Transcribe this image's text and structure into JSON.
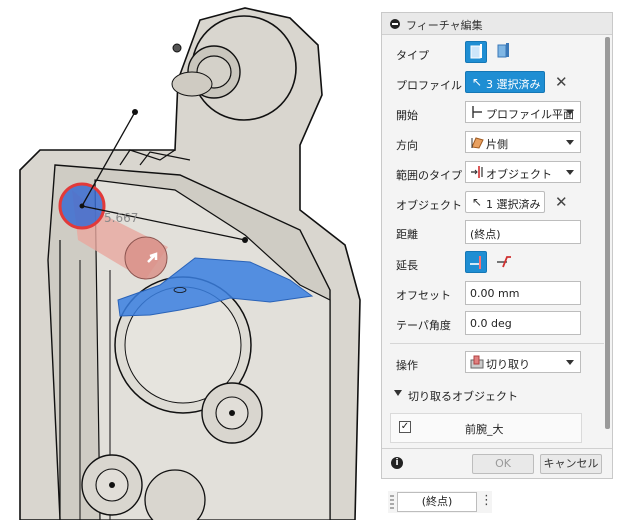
{
  "viewport": {
    "dimension_value": "5.667"
  },
  "panel": {
    "title": "フィーチャ編集",
    "rows": {
      "type": {
        "label": "タイプ"
      },
      "profile": {
        "label": "プロファイル",
        "value": "3 選択済み"
      },
      "start": {
        "label": "開始",
        "value": "プロファイル平面"
      },
      "direction": {
        "label": "方向",
        "value": "片側"
      },
      "extent_type": {
        "label": "範囲のタイプ",
        "value": "オブジェクト"
      },
      "object": {
        "label": "オブジェクト",
        "value": "1 選択済み"
      },
      "distance": {
        "label": "距離",
        "value": "(終点)"
      },
      "extend": {
        "label": "延長"
      },
      "offset": {
        "label": "オフセット",
        "value": "0.00 mm"
      },
      "taper": {
        "label": "テーパ角度",
        "value": "0.0 deg"
      },
      "operation": {
        "label": "操作",
        "value": "切り取り"
      }
    },
    "section": {
      "title": "切り取るオブジェクト",
      "item_label": "前腕_大",
      "item_checked": true
    },
    "footer": {
      "ok_label": "OK",
      "cancel_label": "キャンセル"
    }
  },
  "floating_input": {
    "value": "(終点)"
  },
  "colors": {
    "accent": "#1f8ed3",
    "selection_blue": "#3a7fe0",
    "cut_red": "#e23a3a",
    "part_fill": "#dad8d1"
  }
}
